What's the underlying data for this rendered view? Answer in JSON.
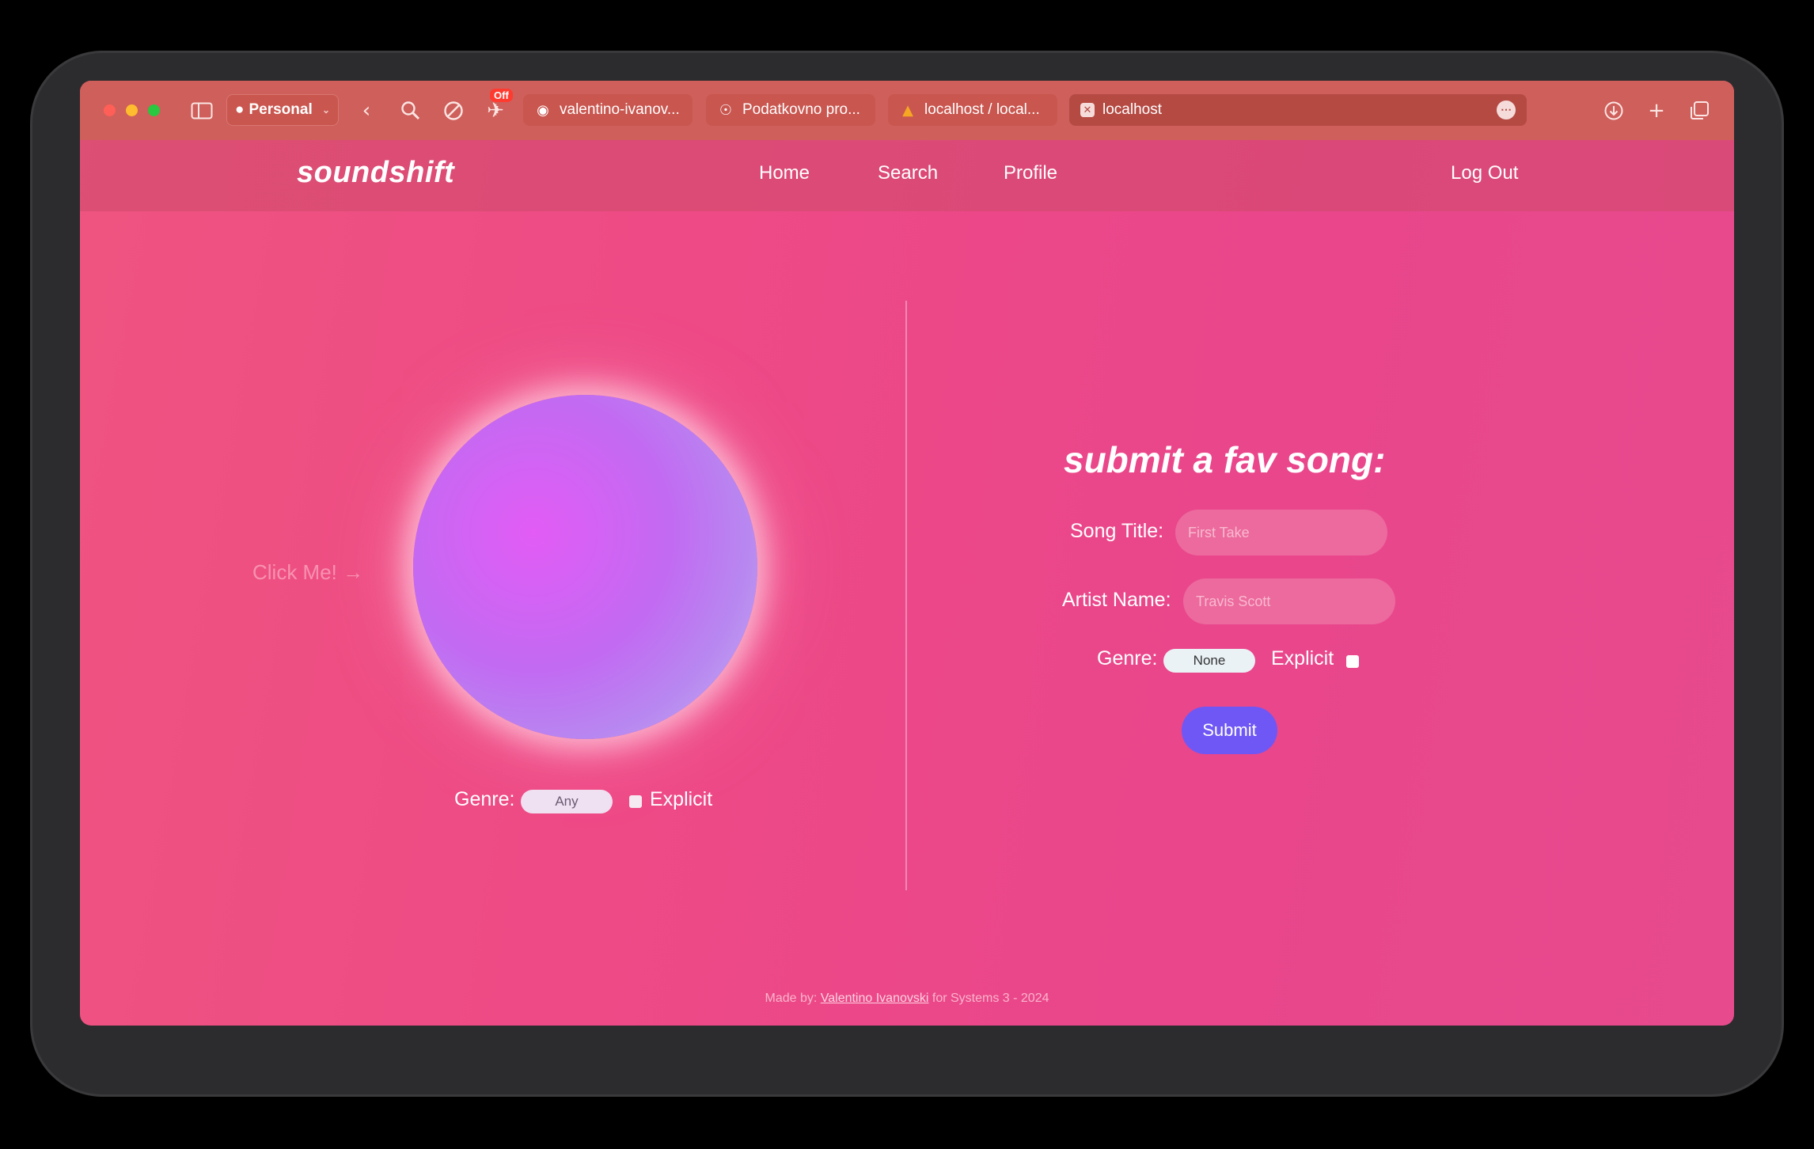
{
  "browser": {
    "profile_label": "Personal",
    "badge": "Off",
    "tabs": [
      {
        "title": "valentino-ivanov...",
        "icon": "github-icon"
      },
      {
        "title": "Podatkovno pro...",
        "icon": "compass-icon"
      },
      {
        "title": "localhost / local...",
        "icon": "phpmyadmin-icon"
      },
      {
        "title": "localhost",
        "icon": "close-tab-icon"
      }
    ]
  },
  "site": {
    "logo": "soundshift",
    "nav": {
      "home": "Home",
      "search": "Search",
      "profile": "Profile",
      "logout": "Log Out"
    }
  },
  "left": {
    "click_me": "Click Me! →",
    "genre_label": "Genre:",
    "genre_value": "Any",
    "explicit_label": "Explicit"
  },
  "form": {
    "title": "submit a fav song:",
    "song_title_label": "Song Title:",
    "song_title_placeholder": "First Take",
    "artist_label": "Artist Name:",
    "artist_placeholder": "Travis Scott",
    "genre_label": "Genre:",
    "genre_value": "None",
    "explicit_label": "Explicit",
    "submit_label": "Submit"
  },
  "footer": {
    "prefix": "Made by:",
    "author": "Valentino Ivanovski",
    "suffix": "for Systems 3 - 2024"
  },
  "colors": {
    "accent": "#6f57f6",
    "background": "#ec4b87",
    "toolbar": "#cf5f5b"
  }
}
